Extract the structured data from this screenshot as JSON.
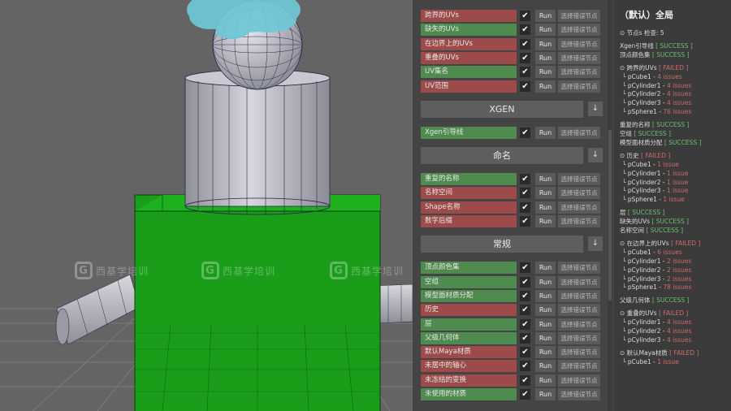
{
  "colors": {
    "failed_row": "#9c4a4a",
    "passed_row": "#4f8a4f",
    "success_text": "#6ec06e",
    "failed_text": "#d06a6a",
    "viewport_bg": "#646464",
    "green_box": "#1a9e1a",
    "hair": "#6fc8d8"
  },
  "watermark": {
    "text": "西基学培训",
    "logo": "G"
  },
  "panel": {
    "run_label": "Run",
    "select_label": "选择错误节点",
    "check_mark": "✔",
    "collapse_icon": "↓",
    "uv_checks": [
      {
        "label": "跨界的UVs",
        "status": "fail",
        "checked": true
      },
      {
        "label": "缺失的UVs",
        "status": "pass",
        "checked": true
      },
      {
        "label": "在边界上的UVs",
        "status": "fail",
        "checked": true
      },
      {
        "label": "重叠的UVs",
        "status": "fail",
        "checked": true
      },
      {
        "label": "UV集名",
        "status": "pass",
        "checked": true
      },
      {
        "label": "UV范围",
        "status": "fail",
        "checked": true
      }
    ],
    "sections": [
      {
        "title": "XGEN",
        "checks": [
          {
            "label": "Xgen引导线",
            "status": "pass",
            "checked": true
          }
        ]
      },
      {
        "title": "命名",
        "checks": [
          {
            "label": "重复的名称",
            "status": "pass",
            "checked": true
          },
          {
            "label": "名称空间",
            "status": "fail",
            "checked": true
          },
          {
            "label": "Shape名称",
            "status": "fail",
            "checked": true
          },
          {
            "label": "数字后缀",
            "status": "fail",
            "checked": true
          }
        ]
      },
      {
        "title": "常规",
        "checks": [
          {
            "label": "顶点颜色集",
            "status": "pass",
            "checked": true
          },
          {
            "label": "空组",
            "status": "pass",
            "checked": true
          },
          {
            "label": "模型面材质分配",
            "status": "pass",
            "checked": true
          },
          {
            "label": "历史",
            "status": "fail",
            "checked": true
          },
          {
            "label": "层",
            "status": "pass",
            "checked": true
          },
          {
            "label": "父级几何体",
            "status": "pass",
            "checked": true
          },
          {
            "label": "默认Maya材质",
            "status": "fail",
            "checked": true
          },
          {
            "label": "未居中的轴心",
            "status": "fail",
            "checked": true
          },
          {
            "label": "未冻结的变换",
            "status": "fail",
            "checked": true
          },
          {
            "label": "未使用的材质",
            "status": "pass",
            "checked": true
          }
        ]
      }
    ]
  },
  "results": {
    "title": "（默认）全局",
    "lines": [
      {
        "parts": [
          {
            "t": "⊙ 节点s 检查: 5",
            "c": ""
          }
        ]
      },
      {
        "parts": [],
        "gap": true
      },
      {
        "parts": [
          {
            "t": "Xgen引导线 ",
            "c": ""
          },
          {
            "t": "[ SUCCESS ]",
            "c": "ok"
          }
        ]
      },
      {
        "parts": [
          {
            "t": "顶点颜色集 ",
            "c": ""
          },
          {
            "t": "[ SUCCESS ]",
            "c": "ok"
          }
        ]
      },
      {
        "parts": [],
        "gap": true
      },
      {
        "parts": [
          {
            "t": "⊙ 跨界的UVs ",
            "c": ""
          },
          {
            "t": "[ FAILED ]",
            "c": "bad"
          }
        ]
      },
      {
        "child": true,
        "parts": [
          {
            "t": "└ pCube1 - ",
            "c": ""
          },
          {
            "t": "4 issues",
            "c": "issue"
          }
        ]
      },
      {
        "child": true,
        "parts": [
          {
            "t": "└ pCylinder1 - ",
            "c": ""
          },
          {
            "t": "4 issues",
            "c": "issue"
          }
        ]
      },
      {
        "child": true,
        "parts": [
          {
            "t": "└ pCylinder2 - ",
            "c": ""
          },
          {
            "t": "4 issues",
            "c": "issue"
          }
        ]
      },
      {
        "child": true,
        "parts": [
          {
            "t": "└ pCylinder3 - ",
            "c": ""
          },
          {
            "t": "4 issues",
            "c": "issue"
          }
        ]
      },
      {
        "child": true,
        "parts": [
          {
            "t": "└ pSphere1 - ",
            "c": ""
          },
          {
            "t": "76 issues",
            "c": "issue"
          }
        ]
      },
      {
        "parts": [],
        "gap": true
      },
      {
        "parts": [
          {
            "t": "重复的名称 ",
            "c": ""
          },
          {
            "t": "[ SUCCESS ]",
            "c": "ok"
          }
        ]
      },
      {
        "parts": [
          {
            "t": "空组 ",
            "c": ""
          },
          {
            "t": "[ SUCCESS ]",
            "c": "ok"
          }
        ]
      },
      {
        "parts": [
          {
            "t": "模型面材质分配 ",
            "c": ""
          },
          {
            "t": "[ SUCCESS ]",
            "c": "ok"
          }
        ]
      },
      {
        "parts": [],
        "gap": true
      },
      {
        "parts": [
          {
            "t": "⊙ 历史 ",
            "c": ""
          },
          {
            "t": "[ FAILED ]",
            "c": "bad"
          }
        ]
      },
      {
        "child": true,
        "parts": [
          {
            "t": "└ pCube1 - ",
            "c": ""
          },
          {
            "t": "1 issue",
            "c": "issue"
          }
        ]
      },
      {
        "child": true,
        "parts": [
          {
            "t": "└ pCylinder1 - ",
            "c": ""
          },
          {
            "t": "1 issue",
            "c": "issue"
          }
        ]
      },
      {
        "child": true,
        "parts": [
          {
            "t": "└ pCylinder2 - ",
            "c": ""
          },
          {
            "t": "1 issue",
            "c": "issue"
          }
        ]
      },
      {
        "child": true,
        "parts": [
          {
            "t": "└ pCylinder3 - ",
            "c": ""
          },
          {
            "t": "1 issue",
            "c": "issue"
          }
        ]
      },
      {
        "child": true,
        "parts": [
          {
            "t": "└ pSphere1 - ",
            "c": ""
          },
          {
            "t": "1 issue",
            "c": "issue"
          }
        ]
      },
      {
        "parts": [],
        "gap": true
      },
      {
        "parts": [
          {
            "t": "层 ",
            "c": ""
          },
          {
            "t": "[ SUCCESS ]",
            "c": "ok"
          }
        ]
      },
      {
        "parts": [
          {
            "t": "缺失的UVs ",
            "c": ""
          },
          {
            "t": "[ SUCCESS ]",
            "c": "ok"
          }
        ]
      },
      {
        "parts": [
          {
            "t": "名称空间 ",
            "c": ""
          },
          {
            "t": "[ SUCCESS ]",
            "c": "ok"
          }
        ]
      },
      {
        "parts": [],
        "gap": true
      },
      {
        "parts": [
          {
            "t": "⊙ 在边界上的UVs ",
            "c": ""
          },
          {
            "t": "[ FAILED ]",
            "c": "bad"
          }
        ]
      },
      {
        "child": true,
        "parts": [
          {
            "t": "└ pCube1 - ",
            "c": ""
          },
          {
            "t": "6 issues",
            "c": "issue"
          }
        ]
      },
      {
        "child": true,
        "parts": [
          {
            "t": "└ pCylinder1 - ",
            "c": ""
          },
          {
            "t": "2 issues",
            "c": "issue"
          }
        ]
      },
      {
        "child": true,
        "parts": [
          {
            "t": "└ pCylinder2 - ",
            "c": ""
          },
          {
            "t": "2 issues",
            "c": "issue"
          }
        ]
      },
      {
        "child": true,
        "parts": [
          {
            "t": "└ pCylinder3 - ",
            "c": ""
          },
          {
            "t": "2 issues",
            "c": "issue"
          }
        ]
      },
      {
        "child": true,
        "parts": [
          {
            "t": "└ pSphere1 - ",
            "c": ""
          },
          {
            "t": "78 issues",
            "c": "issue"
          }
        ]
      },
      {
        "parts": [],
        "gap": true
      },
      {
        "parts": [
          {
            "t": "父级几何体 ",
            "c": ""
          },
          {
            "t": "[ SUCCESS ]",
            "c": "ok"
          }
        ]
      },
      {
        "parts": [],
        "gap": true
      },
      {
        "parts": [
          {
            "t": "⊙ 重叠的UVs ",
            "c": ""
          },
          {
            "t": "[ FAILED ]",
            "c": "bad"
          }
        ]
      },
      {
        "child": true,
        "parts": [
          {
            "t": "└ pCylinder1 - ",
            "c": ""
          },
          {
            "t": "4 issues",
            "c": "issue"
          }
        ]
      },
      {
        "child": true,
        "parts": [
          {
            "t": "└ pCylinder2 - ",
            "c": ""
          },
          {
            "t": "4 issues",
            "c": "issue"
          }
        ]
      },
      {
        "child": true,
        "parts": [
          {
            "t": "└ pCylinder3 - ",
            "c": ""
          },
          {
            "t": "4 issues",
            "c": "issue"
          }
        ]
      },
      {
        "parts": [],
        "gap": true
      },
      {
        "parts": [
          {
            "t": "⊙ 默认Maya材质 ",
            "c": ""
          },
          {
            "t": "[ FAILED ]",
            "c": "bad"
          }
        ]
      },
      {
        "child": true,
        "parts": [
          {
            "t": "└ pCube1 - ",
            "c": ""
          },
          {
            "t": "1 issue",
            "c": "issue"
          }
        ]
      }
    ]
  }
}
